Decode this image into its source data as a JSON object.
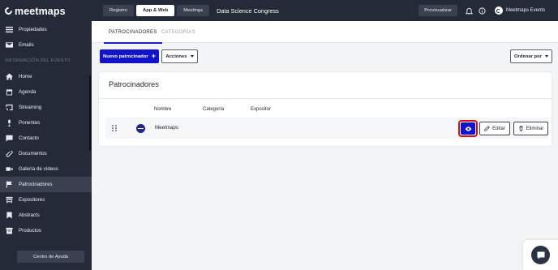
{
  "app": {
    "logo_text": "meetmaps"
  },
  "topbar": {
    "segments": [
      "Registro",
      "App & Web",
      "Meetings"
    ],
    "event_title": "Data Science Congress",
    "preview_label": "Previsualizar",
    "user_name": "Meetmaps Events"
  },
  "sidebar": {
    "top_items": [
      {
        "label": "Propiedades",
        "icon": "list-icon"
      },
      {
        "label": "Emails",
        "icon": "mail-icon"
      }
    ],
    "section_title": "INFORMACIÓN DEL EVENTO",
    "items": [
      {
        "label": "Home",
        "icon": "home-icon"
      },
      {
        "label": "Agenda",
        "icon": "calendar-icon"
      },
      {
        "label": "Streaming",
        "icon": "cast-icon"
      },
      {
        "label": "Ponentes",
        "icon": "microphone-icon"
      },
      {
        "label": "Contacto",
        "icon": "chat-icon"
      },
      {
        "label": "Documentos",
        "icon": "attachment-icon"
      },
      {
        "label": "Galería de vídeos",
        "icon": "video-icon"
      },
      {
        "label": "Patrocinadores",
        "icon": "flag-icon",
        "active": true
      },
      {
        "label": "Expositores",
        "icon": "store-icon"
      },
      {
        "label": "Abstracts",
        "icon": "bookmark-icon"
      },
      {
        "label": "Productos",
        "icon": "archive-icon"
      }
    ],
    "help_label": "Centro de Ayuda"
  },
  "tabs": [
    "PATROCINADORES",
    "CATEGORÍAS"
  ],
  "toolbar": {
    "new_label": "Nuevo patrocinador",
    "actions_label": "Acciones",
    "sort_label": "Ordenar por"
  },
  "card": {
    "title": "Patrocinadores",
    "columns": [
      "Nombre",
      "Categoría",
      "Expositor"
    ],
    "rows": [
      {
        "name": "Meetmaps",
        "category": "",
        "exhibitor": ""
      }
    ],
    "edit_label": "Editar",
    "delete_label": "Eliminar"
  },
  "colors": {
    "sidebar_bg": "#252a38",
    "primary": "#1214c9",
    "highlight": "#d80e1e"
  }
}
